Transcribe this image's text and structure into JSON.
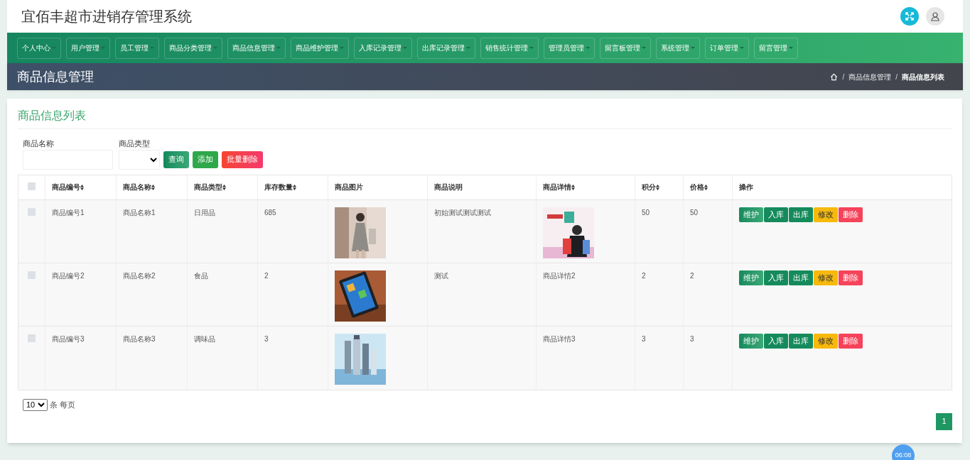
{
  "header": {
    "title": "宜佰丰超市进销存管理系统"
  },
  "nav": [
    "个人中心",
    "用户管理",
    "员工管理",
    "商品分类管理",
    "商品信息管理",
    "商品维护管理",
    "入库记录管理",
    "出库记录管理",
    "销售统计管理",
    "管理员管理",
    "留言板管理",
    "系统管理",
    "订单管理",
    "留言管理"
  ],
  "banner": {
    "title": "商品信息管理",
    "breadcrumb": [
      {
        "kind": "separator",
        "text": "/"
      },
      {
        "kind": "link",
        "text": "商品信息管理"
      },
      {
        "kind": "separator",
        "text": "/"
      },
      {
        "kind": "current",
        "text": "商品信息列表"
      }
    ]
  },
  "card": {
    "title": "商品信息列表"
  },
  "filters": {
    "name_label": "商品名称",
    "type_label": "商品类型",
    "buttons": [
      {
        "label": "查询",
        "kind": "query"
      },
      {
        "label": "添加",
        "kind": "add"
      },
      {
        "label": "批量删除",
        "kind": "delete"
      }
    ]
  },
  "table": {
    "select_all": {
      "checked": false
    },
    "columns": [
      {
        "label": "商品编号",
        "sortable": true
      },
      {
        "label": "商品名称",
        "sortable": true
      },
      {
        "label": "商品类型",
        "sortable": true
      },
      {
        "label": "库存数量",
        "sortable": true
      },
      {
        "label": "商品图片",
        "sortable": false
      },
      {
        "label": "商品说明",
        "sortable": false
      },
      {
        "label": "商品详情",
        "sortable": true
      },
      {
        "label": "积分",
        "sortable": true
      },
      {
        "label": "价格",
        "sortable": true
      },
      {
        "label": "操作",
        "sortable": false
      }
    ],
    "rows": [
      {
        "checked": false,
        "id": "商品编号1",
        "name": "商品名称1",
        "type": "日用品",
        "stock": "685",
        "description": "初始测试测试测试",
        "points": "50",
        "price": "50",
        "actions": [
          {
            "label": "维护",
            "kind": "maintain"
          },
          {
            "label": "入库",
            "kind": "stock-in"
          },
          {
            "label": "出库",
            "kind": "stock-out"
          },
          {
            "label": "修改",
            "kind": "edit"
          },
          {
            "label": "删除",
            "kind": "delete"
          }
        ]
      },
      {
        "checked": false,
        "id": "商品编号2",
        "name": "商品名称2",
        "type": "食品",
        "stock": "2",
        "description": "测试",
        "detail": {
          "kind": "text",
          "text": "商品详情2"
        },
        "points": "2",
        "price": "2",
        "actions": [
          {
            "label": "维护",
            "kind": "maintain"
          },
          {
            "label": "入库",
            "kind": "stock-in"
          },
          {
            "label": "出库",
            "kind": "stock-out"
          },
          {
            "label": "修改",
            "kind": "edit"
          },
          {
            "label": "删除",
            "kind": "delete"
          }
        ]
      },
      {
        "checked": false,
        "id": "商品编号3",
        "name": "商品名称3",
        "type": "调味品",
        "stock": "3",
        "detail": {
          "kind": "text",
          "text": "商品详情3"
        },
        "points": "3",
        "price": "3",
        "actions": [
          {
            "label": "维护",
            "kind": "maintain"
          },
          {
            "label": "入库",
            "kind": "stock-in"
          },
          {
            "label": "出库",
            "kind": "stock-out"
          },
          {
            "label": "修改",
            "kind": "edit"
          },
          {
            "label": "删除",
            "kind": "delete"
          }
        ]
      }
    ]
  },
  "pagination": {
    "page_size": "10",
    "page_size_label": "条 每页",
    "pages": [
      {
        "label": "1",
        "selected": true
      }
    ]
  },
  "clock_badge": "06:08"
}
